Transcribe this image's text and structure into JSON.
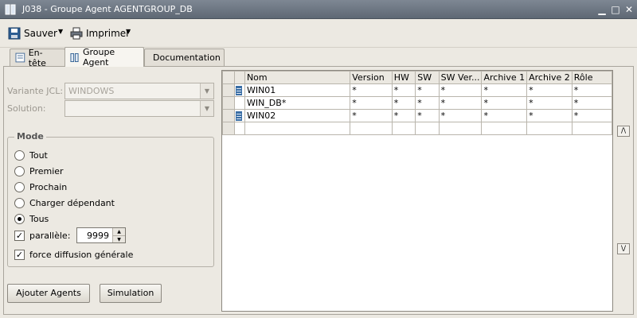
{
  "window": {
    "title": "J038 - Groupe Agent AGENTGROUP_DB"
  },
  "toolbar": {
    "save_label": "Sauver",
    "print_label": "Imprimer"
  },
  "tabs": [
    {
      "label": "En-tête",
      "active": false
    },
    {
      "label": "Groupe Agent",
      "active": true
    },
    {
      "label": "Documentation",
      "active": false
    }
  ],
  "form": {
    "variante_label": "Variante JCL:",
    "variante_value": "WINDOWS",
    "solution_label": "Solution:",
    "solution_value": ""
  },
  "mode": {
    "legend": "Mode",
    "options": [
      "Tout",
      "Premier",
      "Prochain",
      "Charger dépendant",
      "Tous"
    ],
    "selected": "Tous",
    "parallel_label": "parallèle:",
    "parallel_checked": true,
    "parallel_value": "9999",
    "force_label": "force diffusion générale",
    "force_checked": true
  },
  "buttons": {
    "add_agents": "Ajouter Agents",
    "simulation": "Simulation"
  },
  "grid": {
    "columns": [
      "Nom",
      "Version",
      "HW",
      "SW",
      "SW Ver...",
      "Archive 1",
      "Archive 2",
      "Rôle"
    ],
    "rows": [
      {
        "icon": true,
        "cells": [
          "WIN01",
          "*",
          "*",
          "*",
          "*",
          "*",
          "*",
          "*"
        ]
      },
      {
        "icon": false,
        "cells": [
          "WIN_DB*",
          "*",
          "*",
          "*",
          "*",
          "*",
          "*",
          "*"
        ]
      },
      {
        "icon": true,
        "cells": [
          "WIN02",
          "*",
          "*",
          "*",
          "*",
          "*",
          "*",
          "*"
        ]
      },
      {
        "icon": false,
        "cells": [
          "",
          "",
          "",
          "",
          "",
          "",
          "",
          ""
        ]
      }
    ]
  },
  "icons": {
    "app": "agent-group-icon",
    "save": "floppy-disk-icon",
    "print": "printer-icon",
    "row": "agent-server-icon"
  }
}
